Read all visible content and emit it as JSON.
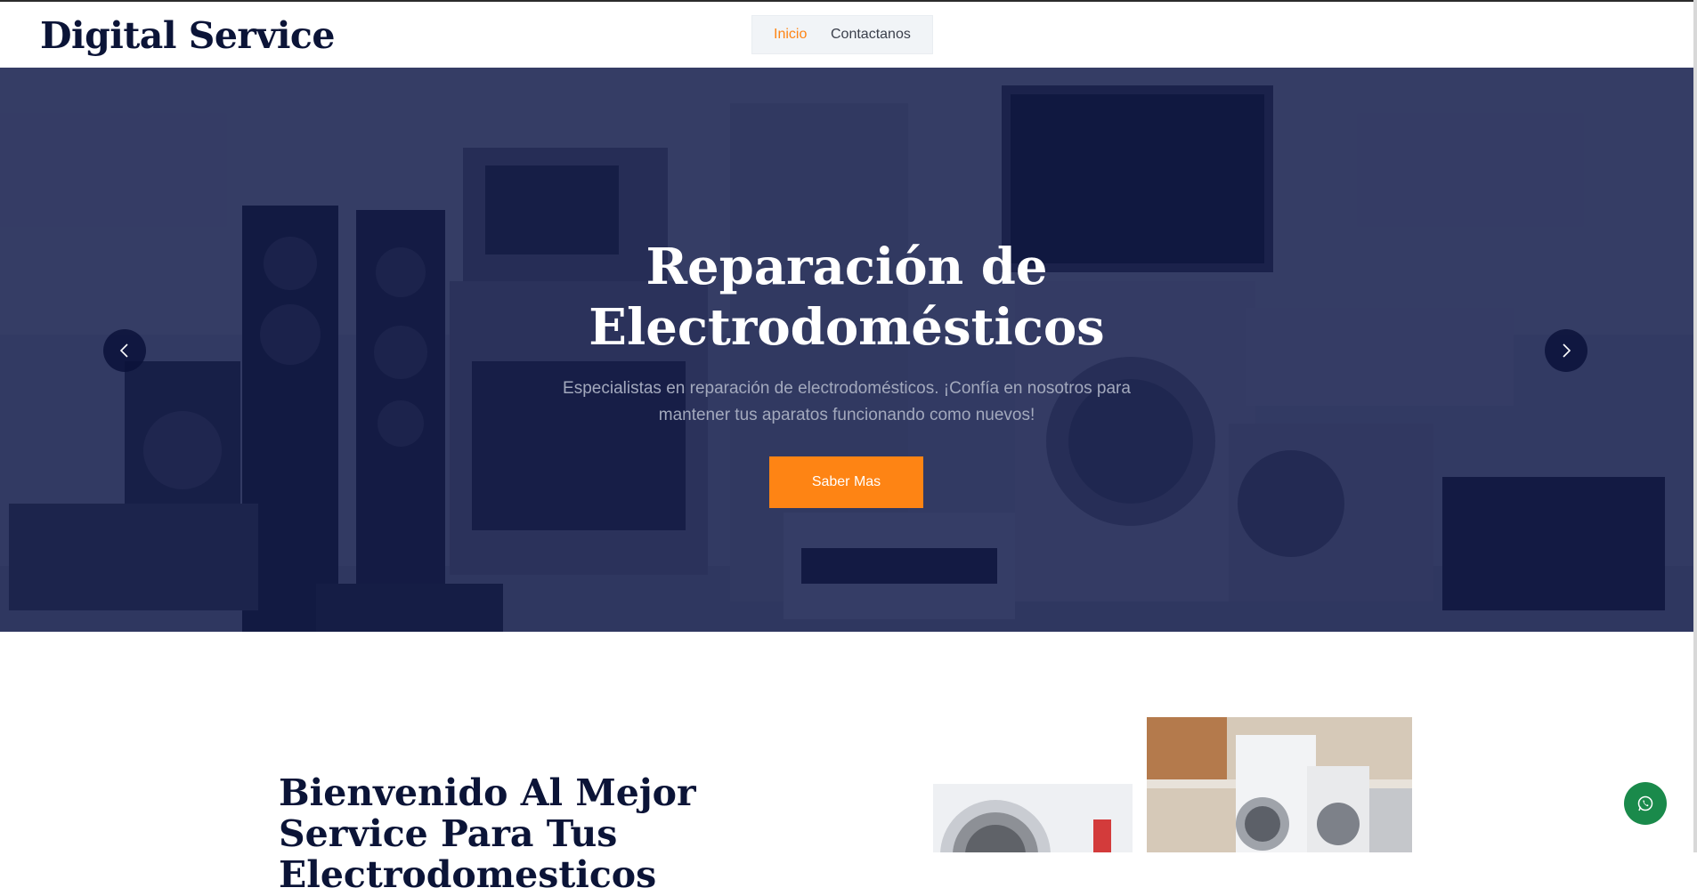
{
  "header": {
    "logo": "Digital Service",
    "nav": [
      {
        "label": "Inicio",
        "active": true
      },
      {
        "label": "Contactanos",
        "active": false
      }
    ]
  },
  "hero": {
    "title": "Reparación de Electrodomésticos",
    "subtitle": "Especialistas en reparación de electrodomésticos. ¡Confía en nosotros para mantener tus aparatos funcionando como nuevos!",
    "button_label": "Saber Mas",
    "prev_icon": "chevron-left-icon",
    "next_icon": "chevron-right-icon"
  },
  "about": {
    "title": "Bienvenido Al Mejor Service Para Tus Electrodomesticos"
  },
  "floating": {
    "icon": "whatsapp-icon"
  },
  "colors": {
    "accent": "#fe8414",
    "navy": "#0b1437",
    "overlay": "#0c1546",
    "whatsapp": "#1a8a4b"
  }
}
